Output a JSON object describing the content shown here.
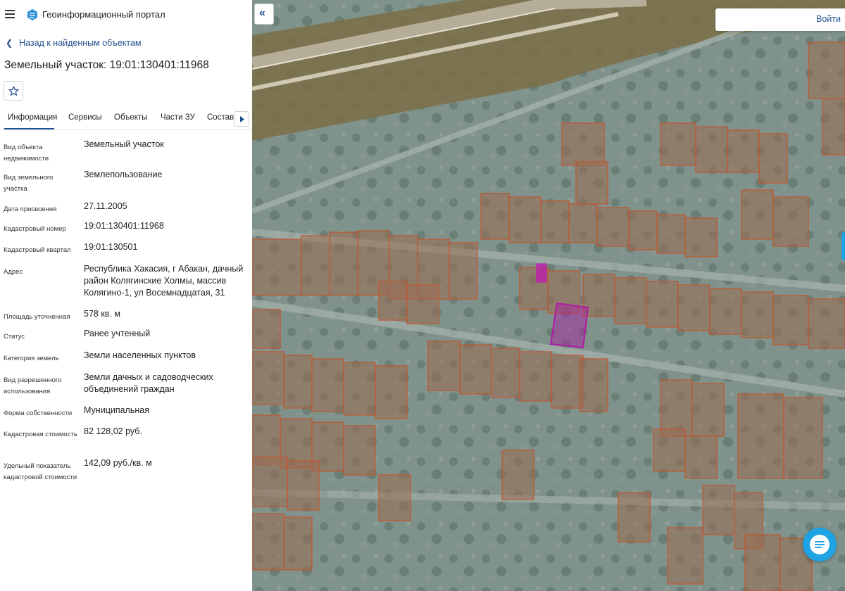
{
  "header": {
    "title": "Геоинформационный портал"
  },
  "nav": {
    "back_label": "Назад к найденным объектам"
  },
  "object": {
    "title": "Земельный участок: 19:01:130401:11968"
  },
  "tabs": [
    {
      "label": "Информация"
    },
    {
      "label": "Сервисы"
    },
    {
      "label": "Объекты"
    },
    {
      "label": "Части ЗУ"
    },
    {
      "label": "Состав"
    }
  ],
  "fields": [
    {
      "label": "Вид объекта недвижимости",
      "value": "Земельный участок"
    },
    {
      "label": "Вид земельного участка",
      "value": "Землепользование"
    },
    {
      "label": "Дата присвоения",
      "value": "27.11.2005"
    },
    {
      "label": "Кадастровый номер",
      "value": "19:01:130401:11968"
    },
    {
      "label": "Кадастровый квартал",
      "value": "19:01:130501"
    },
    {
      "label": "Адрес",
      "value": "Республика Хакасия, г Абакан, дачный район Колягинские Холмы, массив Колягино-1, ул Восемнадцатая, 31"
    },
    {
      "label": "Площадь уточненная",
      "value": "578 кв. м"
    },
    {
      "label": "Статус",
      "value": "Ранее учтенный"
    },
    {
      "label": "Категория земель",
      "value": "Земли населенных пунктов"
    },
    {
      "label": "Вид разрешенного использования",
      "value": "Земли дачных и садоводческих объединений граждан"
    },
    {
      "label": "Форма собственности",
      "value": "Муниципальная"
    },
    {
      "label": "Кадастровая стоимость",
      "value": "82 128,02 руб."
    },
    {
      "label": "Удельный показатель кадастровой стоимости",
      "value": "142,09 руб./кв. м"
    }
  ],
  "map": {
    "login_label": "Войти",
    "collapse_icon": "double-chevron-left-icon",
    "chat_icon": "chat-icon",
    "colors": {
      "parcel_outline": "#c0562f",
      "selected_parcel": "#b01aa5",
      "accent": "#1f4e8c",
      "chat": "#1fa3e4"
    }
  }
}
